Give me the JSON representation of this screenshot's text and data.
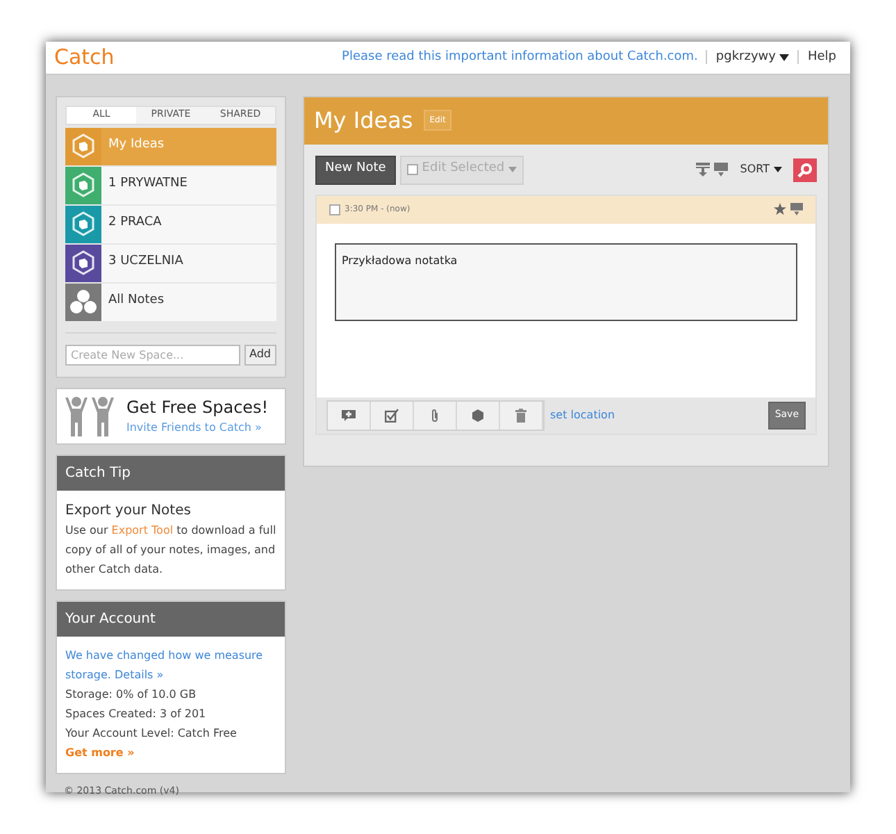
{
  "header": {
    "logo": "Catch",
    "notice_link": "Please read this important information about Catch.com.",
    "user": "pgkrzywy",
    "help": "Help"
  },
  "spaces_panel": {
    "tabs": [
      {
        "label": "ALL",
        "selected": true
      },
      {
        "label": "PRIVATE",
        "selected": false
      },
      {
        "label": "SHARED",
        "selected": false
      }
    ],
    "spaces": [
      {
        "label": "My Ideas",
        "selected": true,
        "color": "#e09a35",
        "kind": "space"
      },
      {
        "label": "1 PRYWATNE",
        "selected": false,
        "color": "#3fae6f",
        "kind": "space"
      },
      {
        "label": "2 PRACA",
        "selected": false,
        "color": "#1a9aa8",
        "kind": "space"
      },
      {
        "label": "3 UCZELNIA",
        "selected": false,
        "color": "#5a4a9e",
        "kind": "space"
      },
      {
        "label": "All Notes",
        "selected": false,
        "color": "#7a7a7a",
        "kind": "all"
      }
    ],
    "new_space_placeholder": "Create New Space...",
    "add_button": "Add"
  },
  "promo": {
    "title": "Get Free Spaces!",
    "link": "Invite Friends to Catch »"
  },
  "tip": {
    "heading": "Catch Tip",
    "title": "Export your Notes",
    "text_before": "Use our ",
    "link": "Export Tool",
    "text_after": " to download a full copy of all of your notes, images, and other Catch data."
  },
  "account": {
    "heading": "Your Account",
    "notice": "We have changed how we measure storage.",
    "details_link": "Details »",
    "lines": [
      "Storage: 0% of 10.0 GB",
      "Spaces Created: 3 of 201",
      "Your Account Level: Catch Free"
    ],
    "more_link": "Get more »"
  },
  "footer": "© 2013 Catch.com (v4)",
  "main": {
    "title": "My Ideas",
    "edit_button": "Edit",
    "new_note": "New Note",
    "edit_selected": {
      "label": "Edit Selected",
      "checked": false
    },
    "sort": "SORT",
    "note": {
      "checked": false,
      "time": "3:30 PM - (now)",
      "text": "Przykładowa notatka",
      "set_location": "set location",
      "save": "Save"
    }
  }
}
